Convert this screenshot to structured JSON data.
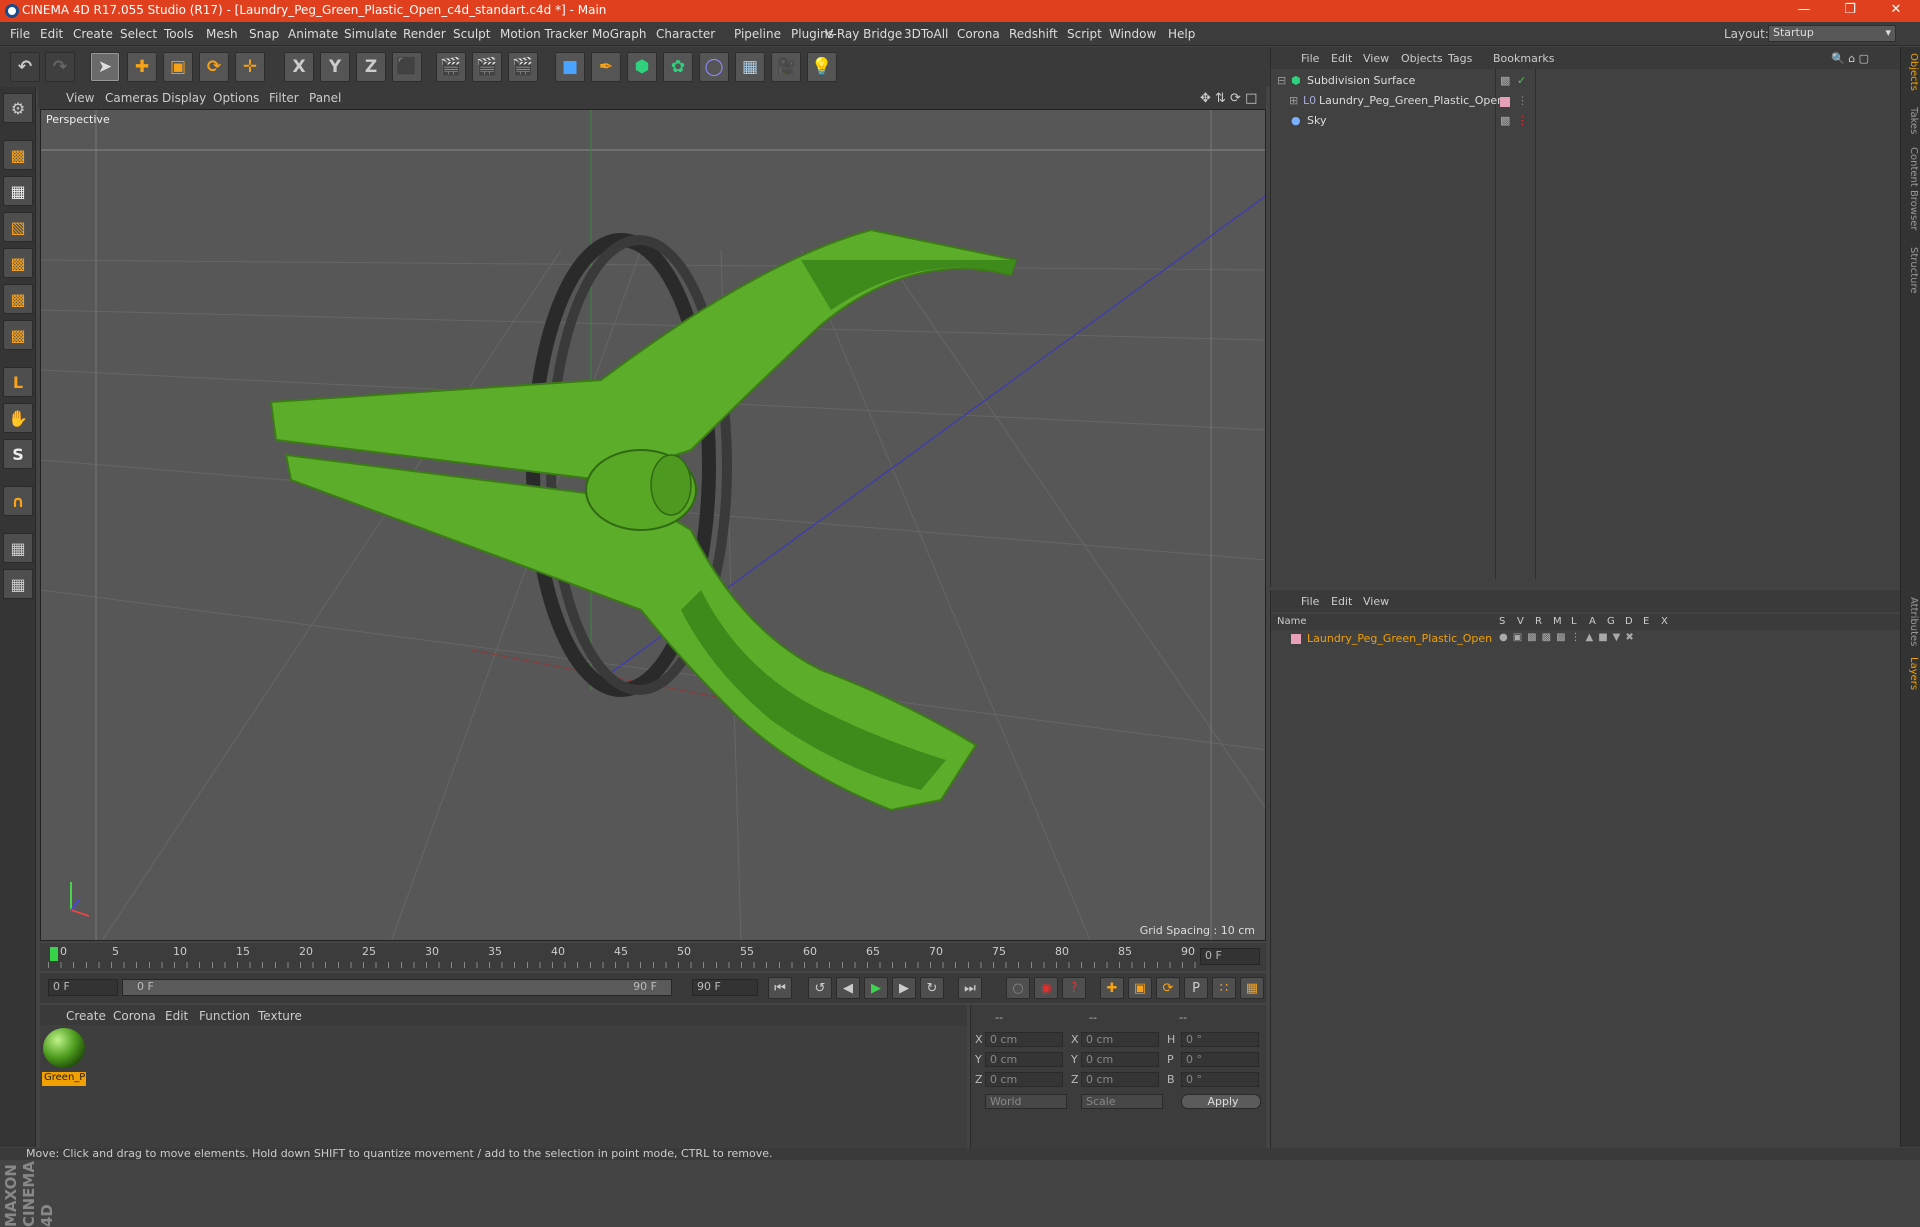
{
  "window": {
    "title": "CINEMA 4D R17.055 Studio (R17) - [Laundry_Peg_Green_Plastic_Open_c4d_standart.c4d *] - Main"
  },
  "menubar": {
    "items": [
      "File",
      "Edit",
      "Create",
      "Select",
      "Tools",
      "Mesh",
      "Snap",
      "Animate",
      "Simulate",
      "Render",
      "Sculpt",
      "Motion Tracker",
      "MoGraph",
      "Character",
      "Pipeline",
      "Plugins",
      "V-Ray Bridge",
      "3DToAll",
      "Corona",
      "Redshift",
      "Script",
      "Window",
      "Help"
    ],
    "layout_label": "Layout:",
    "layout_value": "Startup"
  },
  "viewport": {
    "menu": [
      "View",
      "Cameras",
      "Display",
      "Options",
      "Filter",
      "Panel"
    ],
    "label": "Perspective",
    "grid_spacing": "Grid Spacing : 10 cm"
  },
  "timeline": {
    "ticks": [
      "0",
      "5",
      "10",
      "15",
      "20",
      "25",
      "30",
      "35",
      "40",
      "45",
      "50",
      "55",
      "60",
      "65",
      "70",
      "75",
      "80",
      "85",
      "90"
    ],
    "current_frame": "0 F"
  },
  "playback": {
    "start": "0 F",
    "range_start": "0 F",
    "range_end": "90 F",
    "end": "90 F"
  },
  "material_manager": {
    "menu": [
      "Create",
      "Corona",
      "Edit",
      "Function",
      "Texture"
    ],
    "material_name": "Green_P"
  },
  "coordinates": {
    "header": [
      "--",
      "--",
      "--"
    ],
    "rows": [
      {
        "a": "X",
        "v1": "0 cm",
        "b": "X",
        "v2": "0 cm",
        "c": "H",
        "v3": "0 °"
      },
      {
        "a": "Y",
        "v1": "0 cm",
        "b": "Y",
        "v2": "0 cm",
        "c": "P",
        "v3": "0 °"
      },
      {
        "a": "Z",
        "v1": "0 cm",
        "b": "Z",
        "v2": "0 cm",
        "c": "B",
        "v3": "0 °"
      }
    ],
    "world": "World",
    "scale": "Scale",
    "apply": "Apply"
  },
  "object_manager": {
    "menu": [
      "File",
      "Edit",
      "View",
      "Objects",
      "Tags",
      "Bookmarks"
    ],
    "objects": [
      {
        "name": "Subdivision Surface"
      },
      {
        "name": "Laundry_Peg_Green_Plastic_Open"
      },
      {
        "name": "Sky"
      }
    ]
  },
  "layer_manager": {
    "menu": [
      "File",
      "Edit",
      "View"
    ],
    "columns": [
      "Name",
      "S",
      "V",
      "R",
      "M",
      "L",
      "A",
      "G",
      "D",
      "E",
      "X"
    ],
    "layer": "Laundry_Peg_Green_Plastic_Open"
  },
  "right_tabs": [
    "Objects",
    "Takes",
    "Content Browser",
    "Structure",
    "Attributes",
    "Layers"
  ],
  "status": "Move: Click and drag to move elements. Hold down SHIFT to quantize movement / add to the selection in point mode, CTRL to remove.",
  "brand": "MAXON CINEMA 4D",
  "colors": {
    "title_bar": "#e0401e",
    "accent": "#f0a000",
    "model_green": "#5cae2a"
  }
}
